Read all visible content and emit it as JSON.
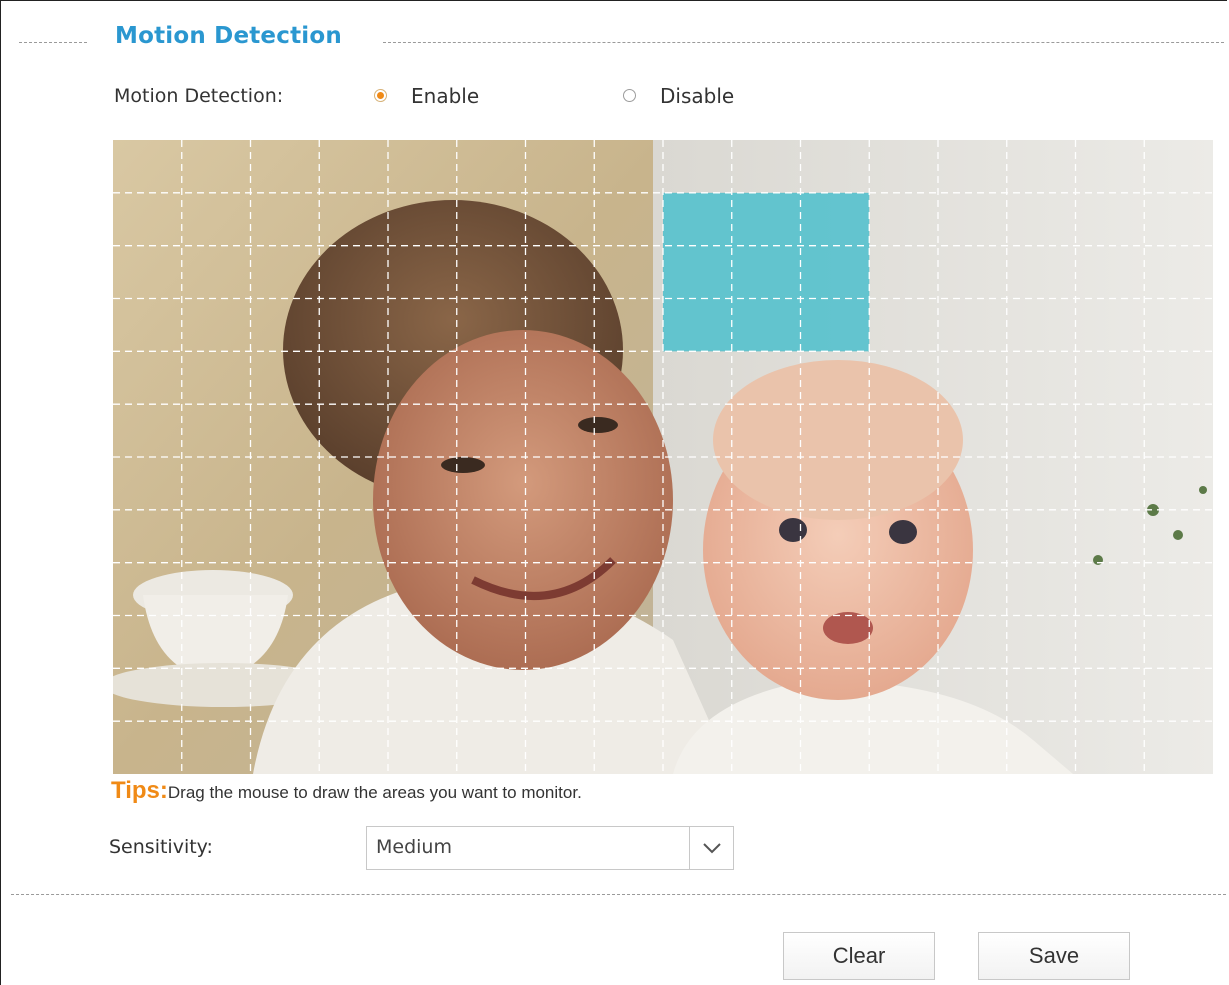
{
  "section": {
    "title": "Motion Detection"
  },
  "motion_detection": {
    "label": "Motion Detection:",
    "options": [
      {
        "label": "Enable",
        "selected": true
      },
      {
        "label": "Disable",
        "selected": false
      }
    ]
  },
  "detection_grid": {
    "columns": 16,
    "rows": 12,
    "selected_area": {
      "col_start": 8,
      "col_end": 11,
      "row_start": 1,
      "row_end": 4
    },
    "highlight_color": "#4cc0cc"
  },
  "tips": {
    "label": "Tips:",
    "text": "Drag the mouse to draw the areas you want to monitor."
  },
  "sensitivity": {
    "label": "Sensitivity:",
    "value": "Medium"
  },
  "buttons": {
    "clear": "Clear",
    "save": "Save"
  },
  "colors": {
    "title": "#2a97d0",
    "tips": "#f08a16",
    "radio_selected": "#f08a16"
  }
}
